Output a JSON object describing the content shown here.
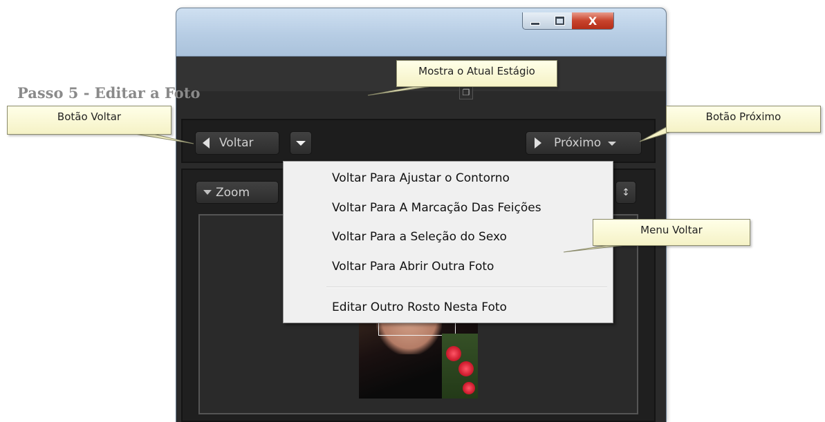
{
  "window": {
    "step_title": "Passo 5 - Editar a Foto",
    "controls": [
      "minimize-icon",
      "maximize-icon",
      "close-icon"
    ],
    "close_label": "X"
  },
  "toolbar": {
    "back_label": "Voltar",
    "next_label": "Próximo",
    "zoom_label": "Zoom"
  },
  "back_menu": {
    "items": [
      "Voltar Para Ajustar o Contorno",
      "Voltar Para A Marcação Das Feições",
      "Voltar Para a Seleção do Sexo",
      "Voltar Para Abrir Outra Foto"
    ],
    "extra_item": "Editar Outro Rosto Nesta Foto"
  },
  "callouts": {
    "current_stage": "Mostra o Atual Estágio",
    "back_button": "Botão Voltar",
    "next_button": "Botão Próximo",
    "back_menu": "Menu Voltar"
  },
  "colors": {
    "panel_bg": "#2a2a2a",
    "titlebar": "#b7cde4",
    "callout_bg": "#f5f2c6",
    "menu_bg": "#f0f0f0"
  }
}
